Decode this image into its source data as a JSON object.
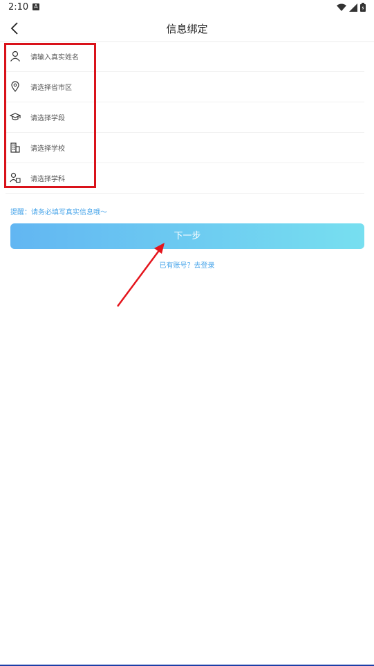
{
  "status_bar": {
    "time": "2:10",
    "notif_badge": "A"
  },
  "nav": {
    "title": "信息绑定"
  },
  "form": {
    "rows": [
      {
        "icon": "person-icon",
        "placeholder": "请输入真实姓名"
      },
      {
        "icon": "location-pin-icon",
        "placeholder": "请选择省市区"
      },
      {
        "icon": "graduation-cap-icon",
        "placeholder": "请选择学段"
      },
      {
        "icon": "building-icon",
        "placeholder": "请选择学校"
      },
      {
        "icon": "people-icon",
        "placeholder": "请选择学科"
      }
    ]
  },
  "reminder": "提醒：请务必填写真实信息哦～",
  "next_button": {
    "label": "下一步"
  },
  "login_link": "已有账号？去登录",
  "colors": {
    "accent": "#4aa6ea",
    "button_start": "#62b6f2",
    "button_end": "#77dff0",
    "highlight": "#d9121a"
  }
}
